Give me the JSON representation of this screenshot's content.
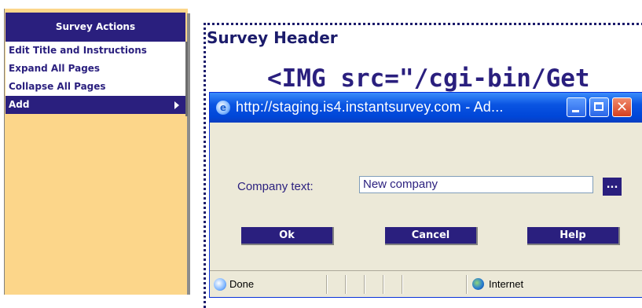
{
  "sidebar": {
    "header": "Survey Actions",
    "items": [
      {
        "label": "Edit Title and Instructions"
      },
      {
        "label": "Expand All Pages"
      },
      {
        "label": "Collapse All Pages"
      },
      {
        "label": "Add"
      }
    ]
  },
  "main": {
    "survey_header": "Survey Header",
    "img_text": "<IMG src=\"/cgi-bin/Get"
  },
  "popup": {
    "title": "http://staging.is4.instantsurvey.com - Ad...",
    "field_label": "Company text:",
    "field_value": "New company",
    "browse_label": "...",
    "ok_label": "Ok",
    "cancel_label": "Cancel",
    "help_label": "Help",
    "status_text": "Done",
    "zone_text": "Internet"
  },
  "colors": {
    "accent": "#2a1f7e",
    "sidebar_bg": "#fcd68a",
    "xp_titlebar": "#0a54e2"
  }
}
